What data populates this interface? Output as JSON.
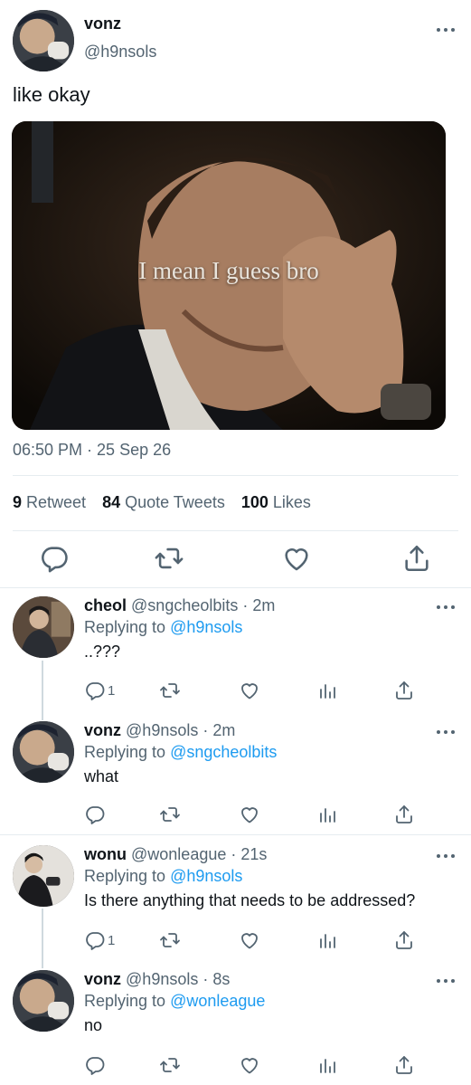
{
  "main_tweet": {
    "name": "vonz",
    "handle": "@h9nsols",
    "text": "like okay",
    "media_caption": "I mean I guess bro",
    "timestamp": "06:50 PM · 25 Sep 26",
    "stats": {
      "retweets_count": "9",
      "retweets_label": "Retweet",
      "quotes_count": "84",
      "quotes_label": "Quote Tweets",
      "likes_count": "100",
      "likes_label": "Likes"
    }
  },
  "replies": [
    {
      "name": "cheol",
      "meta": "@sngcheolbits · 2m",
      "replying_prefix": "Replying to ",
      "replying_to": "@h9nsols",
      "text": "..???",
      "reply_count": "1"
    },
    {
      "name": "vonz",
      "meta": "@h9nsols · 2m",
      "replying_prefix": "Replying to ",
      "replying_to": "@sngcheolbits",
      "text": "what",
      "reply_count": ""
    },
    {
      "name": "wonu",
      "meta": "@wonleague · 21s",
      "replying_prefix": "Replying to ",
      "replying_to": "@h9nsols",
      "text": "Is there anything that needs to be addressed?",
      "reply_count": "1"
    },
    {
      "name": "vonz",
      "meta": "@h9nsols · 8s",
      "replying_prefix": "Replying to ",
      "replying_to": "@wonleague",
      "text": "no",
      "reply_count": ""
    }
  ],
  "colors": {
    "link": "#1d9bf0",
    "muted": "#536471",
    "text": "#0f1419",
    "divider": "#e6ecf0"
  },
  "icons": [
    "more-icon",
    "reply-icon",
    "retweet-icon",
    "like-icon",
    "share-icon",
    "analytics-icon"
  ]
}
